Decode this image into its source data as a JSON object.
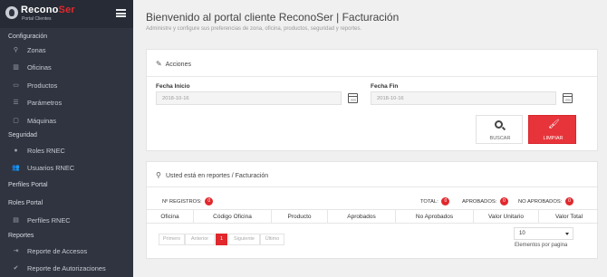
{
  "brand": {
    "name_part1": "Recono",
    "name_part2": "Ser",
    "subtitle": "Portal Clientes"
  },
  "sidebar": {
    "sections": [
      {
        "label": "Configuración"
      },
      {
        "label": "Seguridad"
      },
      {
        "label": "Perfiles Portal"
      },
      {
        "label": "Roles Portal"
      },
      {
        "label": "Reportes"
      }
    ],
    "items": [
      {
        "label": "Zonas",
        "icon": "map-marker-icon"
      },
      {
        "label": "Oficinas",
        "icon": "building-icon"
      },
      {
        "label": "Productos",
        "icon": "box-icon"
      },
      {
        "label": "Parámetros",
        "icon": "sliders-icon"
      },
      {
        "label": "Máquinas",
        "icon": "monitor-icon"
      },
      {
        "label": "Roles RNEC",
        "icon": "user-icon"
      },
      {
        "label": "Usuarios RNEC",
        "icon": "users-icon"
      },
      {
        "label": "Perfiles RNEC",
        "icon": "id-card-icon"
      },
      {
        "label": "Reporte de Accesos",
        "icon": "sign-in-icon"
      },
      {
        "label": "Reporte de Autorizaciones",
        "icon": "check-icon"
      }
    ]
  },
  "header": {
    "title": "Bienvenido al portal cliente ReconoSer | Facturación",
    "description": "Administre y configure sus preferencias de zona, oficina, productos, seguridad y reportes."
  },
  "acciones": {
    "title": "Acciones",
    "fecha_inicio_label": "Fecha Inicio",
    "fecha_inicio_value": "2018-10-16",
    "fecha_fin_label": "Fecha Fin",
    "fecha_fin_value": "2018-10-16",
    "buscar_label": "BUSCAR",
    "limpiar_label": "LIMPIAR"
  },
  "reportes": {
    "breadcrumb": "Usted está en reportes / Facturación",
    "registros_label": "Nº REGISTROS:",
    "registros_count": "0",
    "total_label": "TOTAL:",
    "total_count": "0",
    "aprobados_label": "APROBADOS:",
    "aprobados_count": "0",
    "no_aprobados_label": "NO APROBADOS:",
    "no_aprobados_count": "0",
    "columns": [
      "Oficina",
      "Código Oficina",
      "Producto",
      "Aprobados",
      "No Aprobados",
      "Valor Unitario",
      "Valor Total"
    ],
    "pagination": {
      "first": "Primero",
      "prev": "Anterior",
      "current": "1",
      "next": "Siguiente",
      "last": "Último"
    },
    "page_size_value": "10",
    "page_size_help": "Elementos por pagina"
  },
  "colors": {
    "sidebar_bg": "#2f3440",
    "accent": "#e1282d",
    "content_bg": "#f0f0f0"
  }
}
